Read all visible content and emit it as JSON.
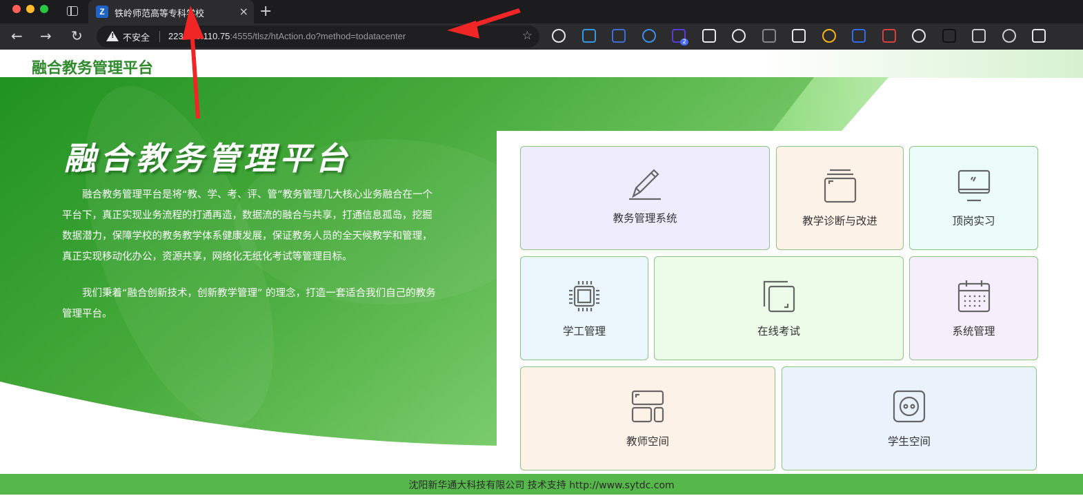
{
  "browser": {
    "tab": {
      "favicon": "Z",
      "title": "铁岭师范高等专科学校",
      "close": "×"
    },
    "new_tab": "+",
    "nav": {
      "back": "←",
      "forward": "→",
      "reload": "↻"
    },
    "address": {
      "security_label": "不安全",
      "url_host": "223.100.110.75",
      "url_rest": ":4555/tlsz/htAction.do?method=todatacenter"
    },
    "extensions": [
      "todo-icon",
      "circle-icon",
      "bird-icon",
      "pin-icon",
      "badge-icon",
      "portrait-icon",
      "cloud-icon",
      "hat-icon",
      "robot-icon",
      "chart-icon",
      "bars-icon",
      "santa-icon",
      "face-icon",
      "h-icon",
      "puzzle-icon",
      "download-icon",
      "panda-icon"
    ],
    "extension_badge": "2"
  },
  "header": {
    "logo": "融合教务管理平台"
  },
  "hero": {
    "title": "融合教务管理平台",
    "p1": "融合教务管理平台是将“教、学、考、评、管”教务管理几大核心业务融合在一个平台下，真正实现业务流程的打通再造，数据流的融合与共享，打通信息孤岛，挖掘数据潜力，保障学校的教务教学体系健康发展，保证教务人员的全天候教学和管理，真正实现移动化办公，资源共享，网络化无纸化考试等管理目标。",
    "p2": "我们秉着“融合创新技术，创新教学管理” 的理念，打造一套适合我们自己的教务管理平台。"
  },
  "modules": [
    {
      "label": "教务管理系统",
      "icon": "pencil-icon",
      "bg": "#efecfd"
    },
    {
      "label": "教学诊断与改进",
      "icon": "folder-stack-icon",
      "bg": "#fdf2e8"
    },
    {
      "label": "顶岗实习",
      "icon": "monitor-icon",
      "bg": "#eafbf8"
    },
    {
      "label": "学工管理",
      "icon": "chip-icon",
      "bg": "#eaf6fb"
    },
    {
      "label": "在线考试",
      "icon": "copy-icon",
      "bg": "#edfbe9"
    },
    {
      "label": "系统管理",
      "icon": "calendar-icon",
      "bg": "#f6effb"
    },
    {
      "label": "教师空间",
      "icon": "layout-icon",
      "bg": "#fdf2e8"
    },
    {
      "label": "学生空间",
      "icon": "socket-icon",
      "bg": "#eaf2fb"
    }
  ],
  "footer": {
    "text": "沈阳新华通大科技有限公司 技术支持 http://www.sytdc.com"
  },
  "colors": {
    "brand_green": "#3aa335",
    "footer_green": "#56b84b",
    "annotation_red": "#f02626"
  }
}
